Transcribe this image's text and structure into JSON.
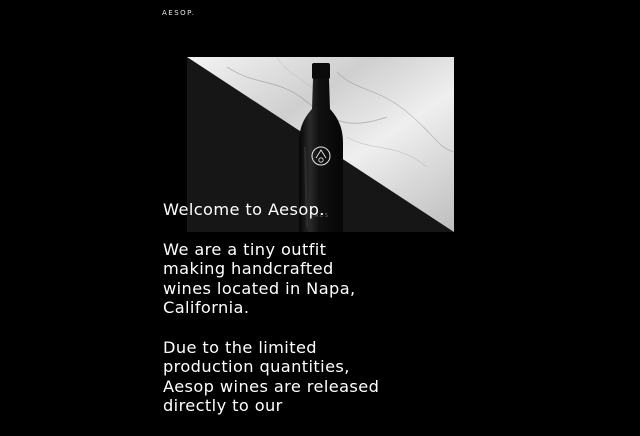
{
  "header": {
    "logo_text": "AESOP."
  },
  "hero": {
    "image": "wine-bottle-on-marble-and-black-diagonal",
    "bottle_mark": "circular-logo-icon",
    "colors": {
      "dark": "#161616",
      "marble": "#d9d9d9",
      "bottle": "#0d0d0d"
    }
  },
  "intro": {
    "welcome": "Welcome to Aesop.",
    "about": "We are a tiny outfit making handcrafted wines located in Napa, California.",
    "release": "Due to the limited production quantities, Aesop wines are released directly to our"
  }
}
